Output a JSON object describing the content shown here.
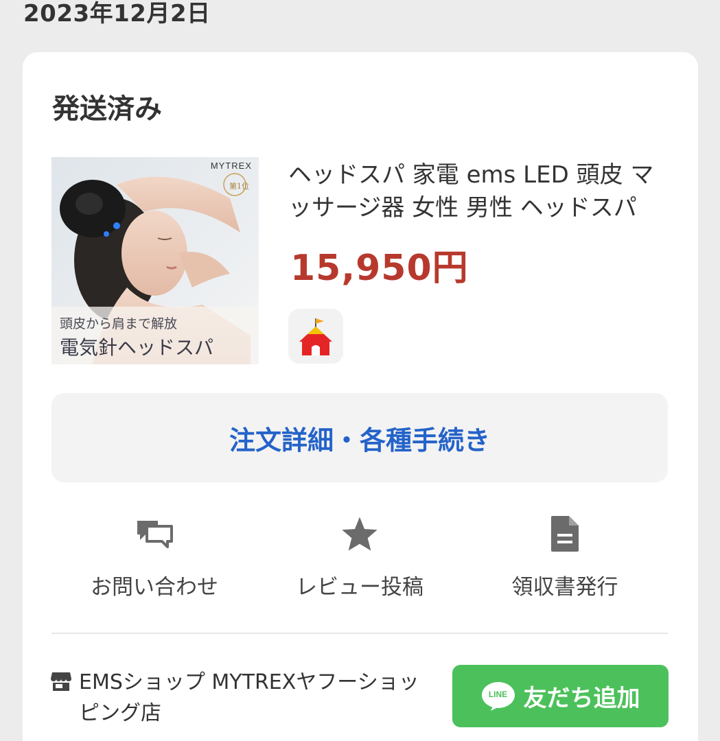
{
  "order": {
    "date": "2023年12月2日",
    "status": "発送済み"
  },
  "product": {
    "name": "ヘッドスパ 家電 ems LED 頭皮 マッサージ器 女性 男性 ヘッドスパ",
    "price": "15,950円",
    "image": {
      "brand": "MYTREX",
      "badge": "第1位",
      "caption_line1": "頭皮から肩まで解放",
      "caption_line2": "電気針ヘッドスパ"
    }
  },
  "details_button_label": "注文詳細・各種手続き",
  "actions": [
    {
      "icon": "chat-bubbles-icon",
      "label": "お問い合わせ"
    },
    {
      "icon": "star-icon",
      "label": "レビュー投稿"
    },
    {
      "icon": "document-icon",
      "label": "領収書発行"
    }
  ],
  "shop": {
    "name": "EMSショップ MYTREXヤフーショッピング店",
    "line_logo_text": "LINE",
    "line_button_label": "友だち追加"
  },
  "colors": {
    "price": "#b7392d",
    "link": "#2463c9",
    "line_green": "#4cc15b",
    "icon_gray": "#6b6b6b"
  }
}
